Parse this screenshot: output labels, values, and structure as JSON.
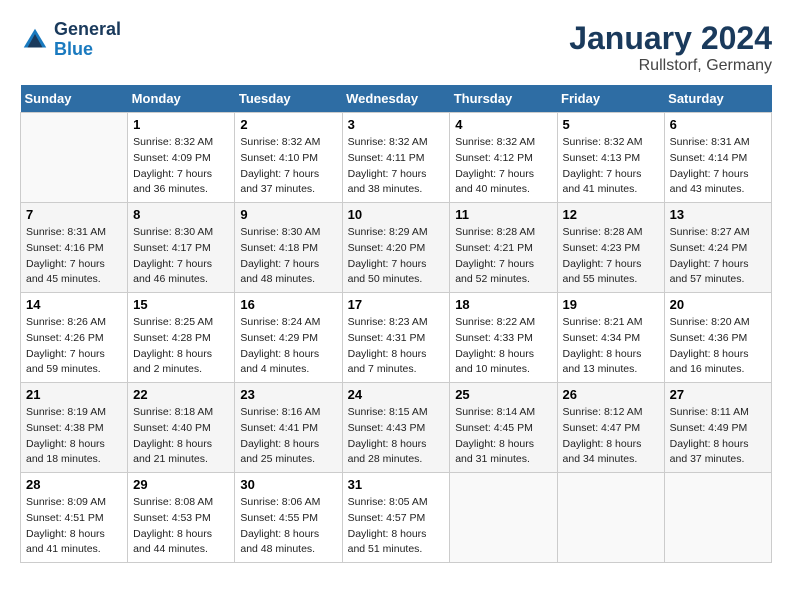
{
  "header": {
    "logo_line1": "General",
    "logo_line2": "Blue",
    "month": "January 2024",
    "location": "Rullstorf, Germany"
  },
  "weekdays": [
    "Sunday",
    "Monday",
    "Tuesday",
    "Wednesday",
    "Thursday",
    "Friday",
    "Saturday"
  ],
  "weeks": [
    [
      {
        "day": null
      },
      {
        "day": 1,
        "sunrise": "8:32 AM",
        "sunset": "4:09 PM",
        "daylight": "7 hours and 36 minutes."
      },
      {
        "day": 2,
        "sunrise": "8:32 AM",
        "sunset": "4:10 PM",
        "daylight": "7 hours and 37 minutes."
      },
      {
        "day": 3,
        "sunrise": "8:32 AM",
        "sunset": "4:11 PM",
        "daylight": "7 hours and 38 minutes."
      },
      {
        "day": 4,
        "sunrise": "8:32 AM",
        "sunset": "4:12 PM",
        "daylight": "7 hours and 40 minutes."
      },
      {
        "day": 5,
        "sunrise": "8:32 AM",
        "sunset": "4:13 PM",
        "daylight": "7 hours and 41 minutes."
      },
      {
        "day": 6,
        "sunrise": "8:31 AM",
        "sunset": "4:14 PM",
        "daylight": "7 hours and 43 minutes."
      }
    ],
    [
      {
        "day": 7,
        "sunrise": "8:31 AM",
        "sunset": "4:16 PM",
        "daylight": "7 hours and 45 minutes."
      },
      {
        "day": 8,
        "sunrise": "8:30 AM",
        "sunset": "4:17 PM",
        "daylight": "7 hours and 46 minutes."
      },
      {
        "day": 9,
        "sunrise": "8:30 AM",
        "sunset": "4:18 PM",
        "daylight": "7 hours and 48 minutes."
      },
      {
        "day": 10,
        "sunrise": "8:29 AM",
        "sunset": "4:20 PM",
        "daylight": "7 hours and 50 minutes."
      },
      {
        "day": 11,
        "sunrise": "8:28 AM",
        "sunset": "4:21 PM",
        "daylight": "7 hours and 52 minutes."
      },
      {
        "day": 12,
        "sunrise": "8:28 AM",
        "sunset": "4:23 PM",
        "daylight": "7 hours and 55 minutes."
      },
      {
        "day": 13,
        "sunrise": "8:27 AM",
        "sunset": "4:24 PM",
        "daylight": "7 hours and 57 minutes."
      }
    ],
    [
      {
        "day": 14,
        "sunrise": "8:26 AM",
        "sunset": "4:26 PM",
        "daylight": "7 hours and 59 minutes."
      },
      {
        "day": 15,
        "sunrise": "8:25 AM",
        "sunset": "4:28 PM",
        "daylight": "8 hours and 2 minutes."
      },
      {
        "day": 16,
        "sunrise": "8:24 AM",
        "sunset": "4:29 PM",
        "daylight": "8 hours and 4 minutes."
      },
      {
        "day": 17,
        "sunrise": "8:23 AM",
        "sunset": "4:31 PM",
        "daylight": "8 hours and 7 minutes."
      },
      {
        "day": 18,
        "sunrise": "8:22 AM",
        "sunset": "4:33 PM",
        "daylight": "8 hours and 10 minutes."
      },
      {
        "day": 19,
        "sunrise": "8:21 AM",
        "sunset": "4:34 PM",
        "daylight": "8 hours and 13 minutes."
      },
      {
        "day": 20,
        "sunrise": "8:20 AM",
        "sunset": "4:36 PM",
        "daylight": "8 hours and 16 minutes."
      }
    ],
    [
      {
        "day": 21,
        "sunrise": "8:19 AM",
        "sunset": "4:38 PM",
        "daylight": "8 hours and 18 minutes."
      },
      {
        "day": 22,
        "sunrise": "8:18 AM",
        "sunset": "4:40 PM",
        "daylight": "8 hours and 21 minutes."
      },
      {
        "day": 23,
        "sunrise": "8:16 AM",
        "sunset": "4:41 PM",
        "daylight": "8 hours and 25 minutes."
      },
      {
        "day": 24,
        "sunrise": "8:15 AM",
        "sunset": "4:43 PM",
        "daylight": "8 hours and 28 minutes."
      },
      {
        "day": 25,
        "sunrise": "8:14 AM",
        "sunset": "4:45 PM",
        "daylight": "8 hours and 31 minutes."
      },
      {
        "day": 26,
        "sunrise": "8:12 AM",
        "sunset": "4:47 PM",
        "daylight": "8 hours and 34 minutes."
      },
      {
        "day": 27,
        "sunrise": "8:11 AM",
        "sunset": "4:49 PM",
        "daylight": "8 hours and 37 minutes."
      }
    ],
    [
      {
        "day": 28,
        "sunrise": "8:09 AM",
        "sunset": "4:51 PM",
        "daylight": "8 hours and 41 minutes."
      },
      {
        "day": 29,
        "sunrise": "8:08 AM",
        "sunset": "4:53 PM",
        "daylight": "8 hours and 44 minutes."
      },
      {
        "day": 30,
        "sunrise": "8:06 AM",
        "sunset": "4:55 PM",
        "daylight": "8 hours and 48 minutes."
      },
      {
        "day": 31,
        "sunrise": "8:05 AM",
        "sunset": "4:57 PM",
        "daylight": "8 hours and 51 minutes."
      },
      {
        "day": null
      },
      {
        "day": null
      },
      {
        "day": null
      }
    ]
  ],
  "labels": {
    "sunrise": "Sunrise:",
    "sunset": "Sunset:",
    "daylight": "Daylight:"
  }
}
